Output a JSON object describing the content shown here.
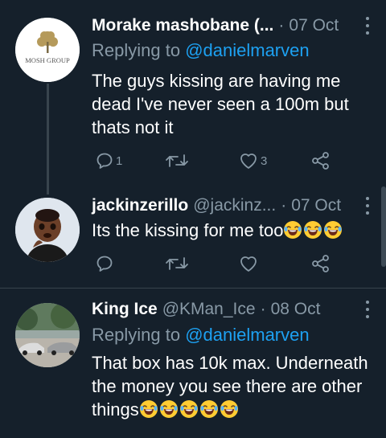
{
  "tweets": [
    {
      "name": "Morake mashobane (...",
      "handle": "",
      "date": "07 Oct",
      "reply_prefix": "Replying to ",
      "reply_to": "@danielmarven",
      "text": "The guys kissing are having me dead I've never seen a 100m but thats not it",
      "emoji_count": 0,
      "reply_count": "1",
      "retweet_count": "",
      "like_count": "3",
      "avatar_text": "MOSH GROUP"
    },
    {
      "name": "jackinzerillo",
      "handle": "@jackinz...",
      "date": "07 Oct",
      "text": "Its the kissing for me too",
      "emoji_count": 3,
      "reply_count": "",
      "retweet_count": "",
      "like_count": ""
    },
    {
      "name": "King Ice",
      "handle": "@KMan_Ice",
      "date": "08 Oct",
      "reply_prefix": "Replying to ",
      "reply_to": "@danielmarven",
      "text_lines": [
        "That box has 10k max. Underneath",
        "the money you see there are other",
        "things"
      ],
      "emoji_count": 5
    }
  ],
  "colors": {
    "background": "#15202b",
    "secondary_text": "#8899a6",
    "mention": "#1da1f2",
    "divider": "#38444d"
  },
  "icons": [
    "reply-icon",
    "retweet-icon",
    "like-icon",
    "share-icon",
    "more-icon",
    "laughing-emoji"
  ]
}
